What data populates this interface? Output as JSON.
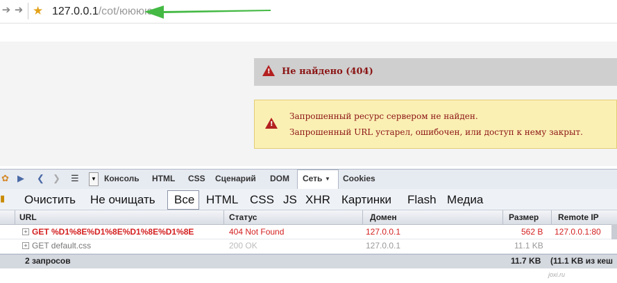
{
  "address_bar": {
    "back_icon": "back-arrow-icon",
    "forward_icon": "forward-arrow-icon",
    "url_host": "127.0.0.1",
    "url_path": "/cot/юююю"
  },
  "error_page": {
    "title": "Не найдено (404)",
    "messages": [
      "Запрошенный ресурс сервером не найден.",
      "Запрошенный URL устарел, ошибочен, или доступ к нему закрыт."
    ],
    "colors": {
      "error_text": "#8b1414",
      "message_bg": "#fbf0b4",
      "title_bg": "#cfcfcf"
    }
  },
  "firebug": {
    "tabs": [
      "Консоль",
      "HTML",
      "CSS",
      "Сценарий",
      "DOM",
      "Сеть",
      "Cookies"
    ],
    "active_tab": "Сеть",
    "net_toolbar": {
      "clear": "Очистить",
      "persist": "Не очищать",
      "filters": [
        "Все",
        "HTML",
        "CSS",
        "JS",
        "XHR",
        "Картинки",
        "Flash",
        "Медиа"
      ],
      "active_filter": "Все"
    },
    "columns": {
      "url": "URL",
      "status": "Статус",
      "domain": "Домен",
      "size": "Размер",
      "remote_ip": "Remote IP"
    },
    "rows": [
      {
        "url": "GET %D1%8E%D1%8E%D1%8E%D1%8E",
        "status": "404 Not Found",
        "domain": "127.0.0.1",
        "size": "562 B",
        "remote_ip": "127.0.0.1:80",
        "error": true
      },
      {
        "url": "GET default.css",
        "status": "200 OK",
        "domain": "127.0.0.1",
        "size": "11.1 KB",
        "remote_ip": "",
        "error": false
      }
    ],
    "summary": {
      "requests": "2 запросов",
      "total_size": "11.7 KB",
      "cached": "(11.1 KB из кеш"
    }
  },
  "watermark": "joxi.ru"
}
